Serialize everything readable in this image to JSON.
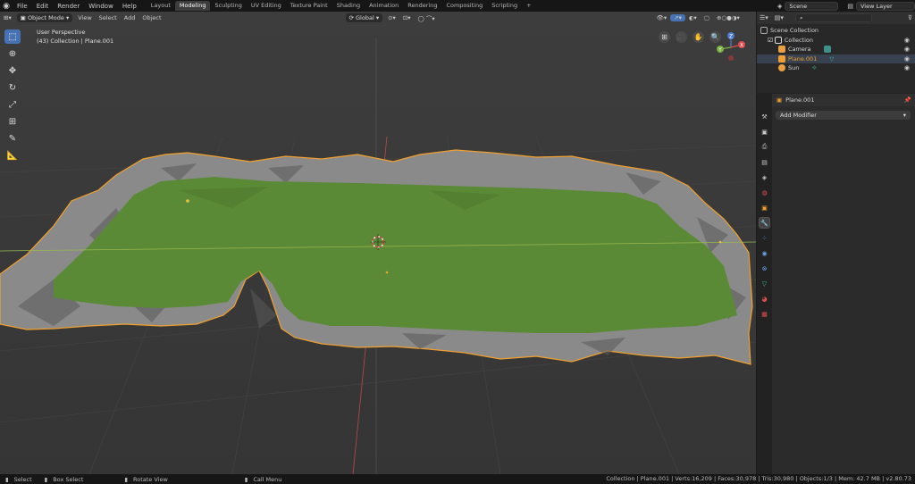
{
  "topbar": {
    "menus": [
      "File",
      "Edit",
      "Render",
      "Window",
      "Help"
    ],
    "workspaces": [
      "Layout",
      "Modeling",
      "Sculpting",
      "UV Editing",
      "Texture Paint",
      "Shading",
      "Animation",
      "Rendering",
      "Compositing",
      "Scripting"
    ],
    "active_workspace": "Modeling",
    "add_tab": "+",
    "scene": "Scene",
    "view_layer": "View Layer"
  },
  "viewport": {
    "mode": "Object Mode",
    "menus": [
      "View",
      "Select",
      "Add",
      "Object"
    ],
    "transform_orientation": "Global",
    "perspective_label": "User Perspective",
    "collection_info": "(43) Collection | Plane.001",
    "gizmo_axes": [
      "Z",
      "Y",
      "X"
    ]
  },
  "toolbar": {
    "tools": [
      "select-box",
      "cursor",
      "move",
      "rotate",
      "scale",
      "transform",
      "annotate",
      "measure"
    ]
  },
  "outliner": {
    "root": "Scene Collection",
    "collection": "Collection",
    "items": [
      {
        "name": "Camera",
        "color": "#e8a040"
      },
      {
        "name": "Plane.001",
        "color": "#f0a030"
      },
      {
        "name": "Sun",
        "color": "#e8a040"
      }
    ]
  },
  "properties": {
    "object_name": "Plane.001",
    "add_modifier": "Add Modifier"
  },
  "statusbar": {
    "select": "Select",
    "box_select": "Box Select",
    "rotate_view": "Rotate View",
    "call_menu": "Call Menu",
    "stats": "Collection | Plane.001 | Verts:16,209 | Faces:30,978 | Tris:30,980 | Objects:1/3 | Mem: 42.7 MB | v2.80.73"
  },
  "colors": {
    "accent": "#4772b3",
    "selection_outline": "#f0a030",
    "grass": "#5a8a35",
    "rock": "#8a8a8a"
  }
}
